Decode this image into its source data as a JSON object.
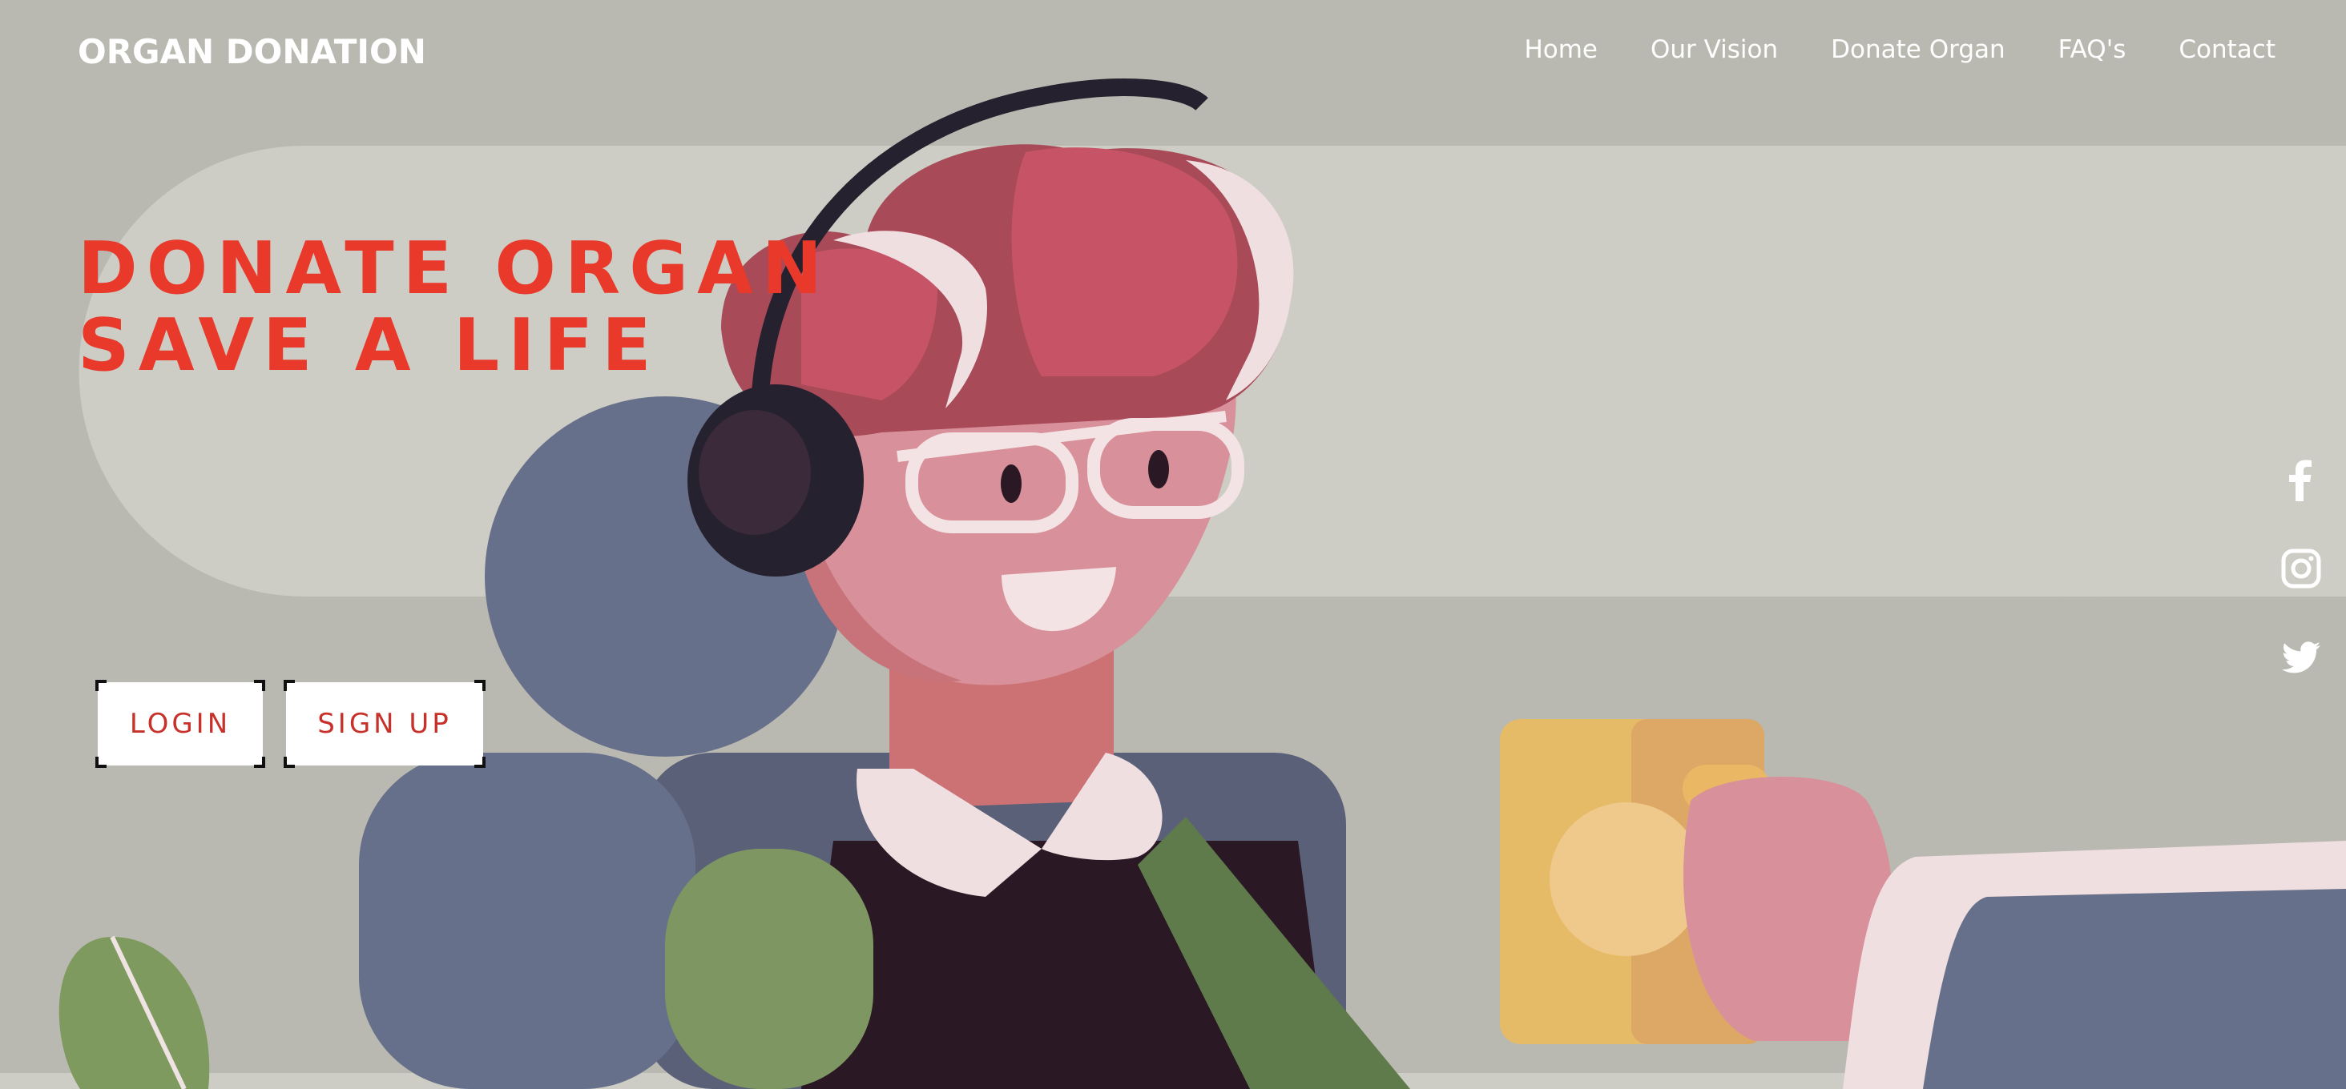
{
  "brand": {
    "title": "ORGAN DONATION"
  },
  "nav": {
    "items": [
      {
        "label": "Home"
      },
      {
        "label": "Our Vision"
      },
      {
        "label": "Donate Organ"
      },
      {
        "label": "FAQ's"
      },
      {
        "label": "Contact"
      }
    ]
  },
  "hero": {
    "line1": "DONATE ORGAN",
    "line2": "SAVE A LIFE"
  },
  "buttons": {
    "login": "LOGIN",
    "signup": "SIGN UP"
  },
  "social": {
    "icons": [
      "facebook-icon",
      "instagram-icon",
      "twitter-icon"
    ]
  },
  "colors": {
    "accent": "#e8392a",
    "button_text": "#c8302a",
    "background": "#b9b9b1"
  }
}
